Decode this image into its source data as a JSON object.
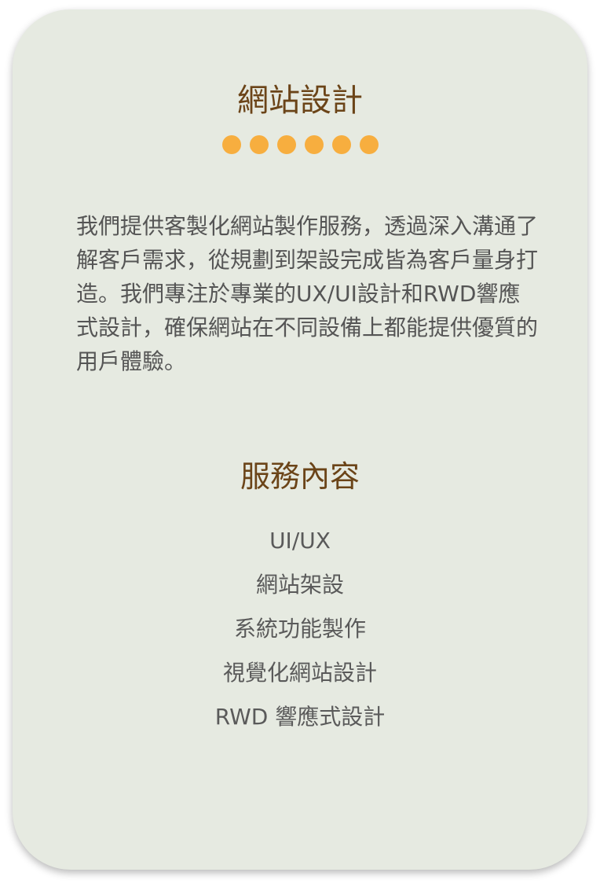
{
  "card": {
    "title": "網站設計",
    "dots_count": 6,
    "intro": "我們提供客製化網站製作服務，透過深入溝通了解客戶需求，從規劃到架設完成皆為客戶量身打造。我們專注於專業的UX/UI設計和RWD響應式設計，確保網站在不同設備上都能提供優質的用戶體驗。",
    "services_title": "服務內容",
    "services": [
      "UI/UX",
      "網站架設",
      "系統功能製作",
      "視覺化網站設計",
      "RWD 響應式設計"
    ]
  },
  "colors": {
    "card_bg": "#e6eae1",
    "heading": "#6b4418",
    "dot": "#f7ae3f",
    "body_text": "#555555"
  }
}
